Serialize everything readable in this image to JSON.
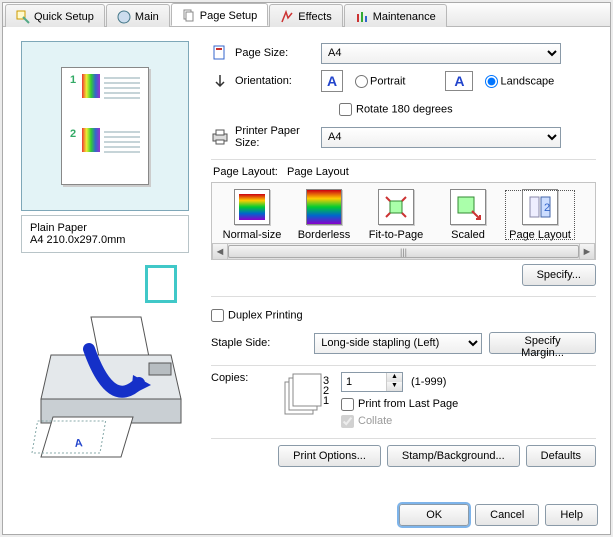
{
  "tabs": {
    "quick_setup": "Quick Setup",
    "main": "Main",
    "page_setup": "Page Setup",
    "effects": "Effects",
    "maintenance": "Maintenance"
  },
  "preview": {
    "media_type": "Plain Paper",
    "dimensions": "A4 210.0x297.0mm"
  },
  "page_size": {
    "label": "Page Size:",
    "value": "A4"
  },
  "orientation": {
    "label": "Orientation:",
    "portrait": "Portrait",
    "landscape": "Landscape",
    "rotate": "Rotate 180 degrees"
  },
  "printer_paper_size": {
    "label": "Printer Paper Size:",
    "value": "A4"
  },
  "page_layout": {
    "label": "Page Layout:",
    "current": "Page Layout",
    "items": [
      "Normal-size",
      "Borderless",
      "Fit-to-Page",
      "Scaled",
      "Page Layout"
    ]
  },
  "buttons": {
    "specify": "Specify...",
    "specify_margin": "Specify Margin...",
    "print_options": "Print Options...",
    "stamp_bg": "Stamp/Background...",
    "defaults": "Defaults",
    "ok": "OK",
    "cancel": "Cancel",
    "help": "Help"
  },
  "duplex": {
    "label": "Duplex Printing"
  },
  "staple": {
    "label": "Staple Side:",
    "value": "Long-side stapling (Left)"
  },
  "copies": {
    "label": "Copies:",
    "value": "1",
    "range": "(1-999)",
    "print_last": "Print from Last Page",
    "collate": "Collate"
  }
}
